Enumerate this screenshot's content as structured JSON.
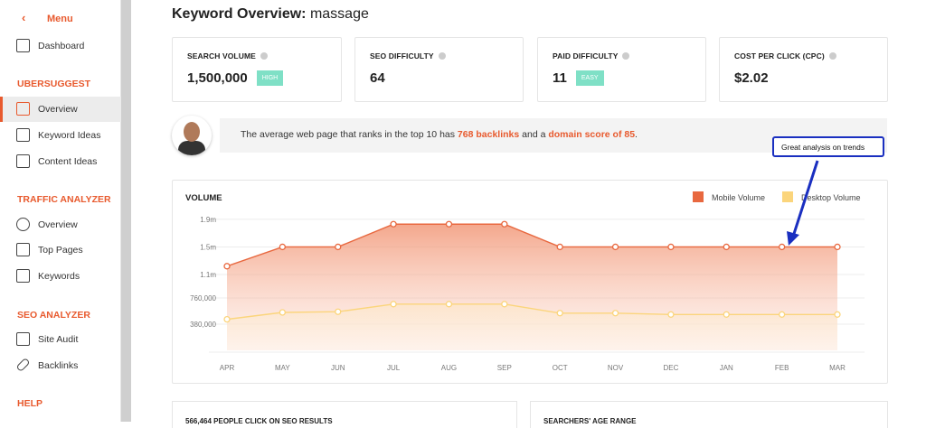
{
  "sidebar": {
    "menu_label": "Menu",
    "dashboard": "Dashboard",
    "section_ubersuggest": "UBERSUGGEST",
    "overview": "Overview",
    "keyword_ideas": "Keyword Ideas",
    "content_ideas": "Content Ideas",
    "section_traffic": "TRAFFIC ANALYZER",
    "traffic_overview": "Overview",
    "top_pages": "Top Pages",
    "keywords": "Keywords",
    "section_seo": "SEO ANALYZER",
    "site_audit": "Site Audit",
    "backlinks": "Backlinks",
    "section_help": "HELP"
  },
  "header": {
    "title_bold": "Keyword Overview:",
    "keyword": "massage"
  },
  "metrics": [
    {
      "label": "SEARCH VOLUME",
      "value": "1,500,000",
      "badge": "HIGH"
    },
    {
      "label": "SEO DIFFICULTY",
      "value": "64"
    },
    {
      "label": "PAID DIFFICULTY",
      "value": "11",
      "badge": "EASY"
    },
    {
      "label": "COST PER CLICK (CPC)",
      "value": "$2.02"
    }
  ],
  "banner": {
    "pre": "The average web page that ranks in the top 10 has ",
    "backlinks": "768 backlinks",
    "mid": " and a ",
    "domain_score": "domain score of 85",
    "post": "."
  },
  "callout": "Great analysis on trends",
  "chart_data": {
    "type": "area",
    "title": "VOLUME",
    "categories": [
      "APR",
      "MAY",
      "JUN",
      "JUL",
      "AUG",
      "SEP",
      "OCT",
      "NOV",
      "DEC",
      "JAN",
      "FEB",
      "MAR"
    ],
    "y_ticks": [
      "1.9m",
      "1.5m",
      "1.1m",
      "760,000",
      "380,000"
    ],
    "y_tick_values": [
      1900000,
      1500000,
      1100000,
      760000,
      380000
    ],
    "ylim": [
      0,
      2200000
    ],
    "series": [
      {
        "name": "Mobile Volume",
        "color": "#e8683f",
        "values": [
          1220000,
          1500000,
          1500000,
          1830000,
          1830000,
          1830000,
          1500000,
          1500000,
          1500000,
          1500000,
          1500000,
          1500000
        ]
      },
      {
        "name": "Desktop Volume",
        "color": "#fbd57c",
        "values": [
          450000,
          550000,
          560000,
          670000,
          670000,
          670000,
          540000,
          540000,
          520000,
          520000,
          520000,
          520000
        ]
      }
    ],
    "legend_position": "top-right",
    "grid": true
  },
  "bottom": {
    "left_title": "566,464 PEOPLE CLICK ON SEO RESULTS",
    "right_title": "SEARCHERS' AGE RANGE"
  }
}
